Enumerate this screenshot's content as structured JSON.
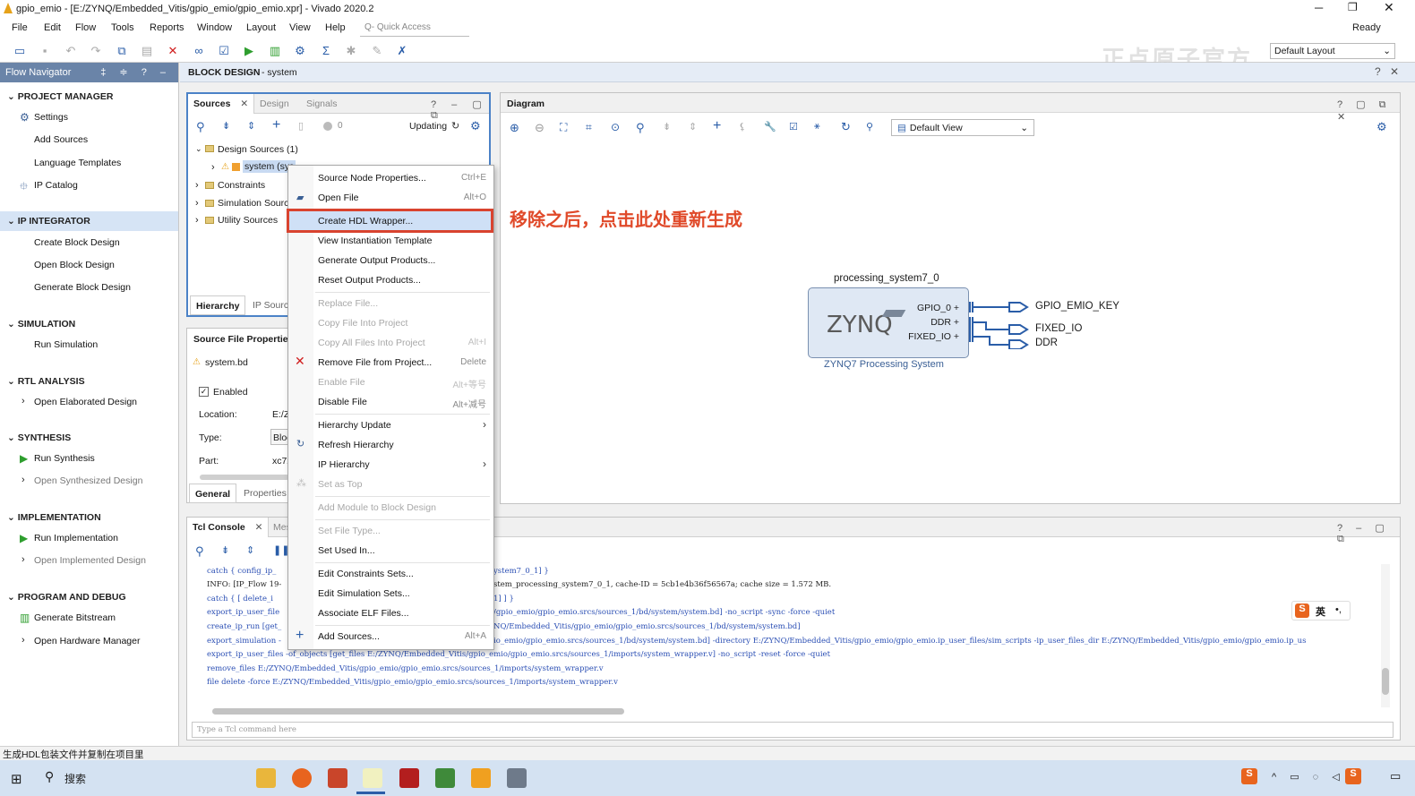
{
  "window": {
    "title": "gpio_emio - [E:/ZYNQ/Embedded_Vitis/gpio_emio/gpio_emio.xpr] - Vivado 2020.2",
    "status": "Ready",
    "watermark": "正点原子官方",
    "layout": "Default Layout"
  },
  "menu": [
    "File",
    "Edit",
    "Flow",
    "Tools",
    "Reports",
    "Window",
    "Layout",
    "View",
    "Help"
  ],
  "quick_access": "Q- Quick Access",
  "flow_nav": {
    "title": "Flow Navigator",
    "sections": [
      {
        "label": "PROJECT MANAGER",
        "items": [
          "Settings",
          "Add Sources",
          "Language Templates",
          "IP Catalog"
        ]
      },
      {
        "label": "IP INTEGRATOR",
        "items": [
          "Create Block Design",
          "Open Block Design",
          "Generate Block Design"
        ]
      },
      {
        "label": "SIMULATION",
        "items": [
          "Run Simulation"
        ]
      },
      {
        "label": "RTL ANALYSIS",
        "items": [
          "Open Elaborated Design"
        ]
      },
      {
        "label": "SYNTHESIS",
        "items": [
          "Run Synthesis",
          "Open Synthesized Design"
        ]
      },
      {
        "label": "IMPLEMENTATION",
        "items": [
          "Run Implementation",
          "Open Implemented Design"
        ]
      },
      {
        "label": "PROGRAM AND DEBUG",
        "items": [
          "Generate Bitstream",
          "Open Hardware Manager"
        ]
      }
    ]
  },
  "block_design": {
    "title": "BLOCK DESIGN",
    "subtitle": "- system"
  },
  "sources": {
    "tabs": [
      "Sources",
      "Design",
      "Signals"
    ],
    "updating": "Updating",
    "count": "0",
    "tree": [
      "Design Sources (1)",
      "system (sys",
      "Constraints",
      "Simulation Source",
      "Utility Sources"
    ],
    "bottom_tabs": [
      "Hierarchy",
      "IP Sourc"
    ]
  },
  "sfp": {
    "title": "Source File Properties",
    "file": "system.bd",
    "enabled": "Enabled",
    "location_label": "Location:",
    "location": "E:/Z",
    "type_label": "Type:",
    "type": "Bloc",
    "part_label": "Part:",
    "part": "xc7z",
    "tabs": [
      "General",
      "Properties"
    ]
  },
  "context_menu": [
    {
      "label": "Source Node Properties...",
      "shortcut": "Ctrl+E",
      "state": "enabled"
    },
    {
      "label": "Open File",
      "shortcut": "Alt+O",
      "state": "enabled"
    },
    {
      "label": "Create HDL Wrapper...",
      "shortcut": "",
      "state": "highlighted"
    },
    {
      "label": "View Instantiation Template",
      "shortcut": "",
      "state": "enabled"
    },
    {
      "label": "Generate Output Products...",
      "shortcut": "",
      "state": "enabled"
    },
    {
      "label": "Reset Output Products...",
      "shortcut": "",
      "state": "enabled"
    },
    {
      "label": "Replace File...",
      "shortcut": "",
      "state": "disabled"
    },
    {
      "label": "Copy File Into Project",
      "shortcut": "",
      "state": "disabled"
    },
    {
      "label": "Copy All Files Into Project",
      "shortcut": "Alt+I",
      "state": "disabled"
    },
    {
      "label": "Remove File from Project...",
      "shortcut": "Delete",
      "state": "enabled"
    },
    {
      "label": "Enable File",
      "shortcut": "Alt+等号",
      "state": "disabled"
    },
    {
      "label": "Disable File",
      "shortcut": "Alt+减号",
      "state": "enabled"
    },
    {
      "label": "Hierarchy Update",
      "shortcut": "›",
      "state": "enabled"
    },
    {
      "label": "Refresh Hierarchy",
      "shortcut": "",
      "state": "enabled"
    },
    {
      "label": "IP Hierarchy",
      "shortcut": "›",
      "state": "enabled"
    },
    {
      "label": "Set as Top",
      "shortcut": "",
      "state": "disabled"
    },
    {
      "label": "Add Module to Block Design",
      "shortcut": "",
      "state": "disabled"
    },
    {
      "label": "Set File Type...",
      "shortcut": "",
      "state": "disabled"
    },
    {
      "label": "Set Used In...",
      "shortcut": "",
      "state": "enabled"
    },
    {
      "label": "Edit Constraints Sets...",
      "shortcut": "",
      "state": "enabled"
    },
    {
      "label": "Edit Simulation Sets...",
      "shortcut": "",
      "state": "enabled"
    },
    {
      "label": "Associate ELF Files...",
      "shortcut": "",
      "state": "enabled"
    },
    {
      "label": "Add Sources...",
      "shortcut": "Alt+A",
      "state": "enabled"
    }
  ],
  "annotation": "移除之后，点击此处重新生成",
  "diagram": {
    "title": "Diagram",
    "view": "Default View",
    "block_name": "processing_system7_0",
    "block_caption": "ZYNQ7 Processing System",
    "logo": "ZYNQ",
    "ports_left": [
      "GPIO_0",
      "DDR",
      "FIXED_IO"
    ],
    "ports_right": [
      "GPIO_EMIO_KEY",
      "FIXED_IO",
      "DDR"
    ]
  },
  "tcl": {
    "tabs": [
      "Tcl Console",
      "Mes"
    ],
    "placeholder": "Type a Tcl command here",
    "lines": [
      "catch { config_ip_",
      "INFO: [IP_Flow 19-",
      "catch { [ delete_i",
      "export_ip_user_file",
      "create_ip_run [get_",
      "export_simulation -",
      "export_ip_user_files -of_objects  [get_files E:/ZYNQ/Embedded_Vitis/gpio_emio/gpio_emio.srcs/sources_1/imports/system_wrapper.v] -no_script -reset -force -quiet",
      "remove_files  E:/ZYNQ/Embedded_Vitis/gpio_emio/gpio_emio.srcs/sources_1/imports/system_wrapper.v",
      "file delete -force E:/ZYNQ/Embedded_Vitis/gpio_emio/gpio_emio.srcs/sources_1/imports/system_wrapper.v"
    ],
    "right_lines": [
      "ystem7_0_1] }",
      "stem_processing_system7_0_1, cache-ID = 5cb1e4b36f56567a; cache size = 1.572 MB.",
      "1] ] }",
      "/gpio_emio/gpio_emio.srcs/sources_1/bd/system/system.bd] -no_script -sync -force -quiet",
      "NQ/Embedded_Vitis/gpio_emio/gpio_emio.srcs/sources_1/bd/system/system.bd]",
      "io_emio/gpio_emio.srcs/sources_1/bd/system/system.bd] -directory E:/ZYNQ/Embedded_Vitis/gpio_emio/gpio_emio.ip_user_files/sim_scripts -ip_user_files_dir E:/ZYNQ/Embedded_Vitis/gpio_emio/gpio_emio.ip_us"
    ]
  },
  "statusbar": "生成HDL包装文件并复制在项目里",
  "taskbar": {
    "search": "搜索",
    "ime": "英"
  },
  "colors": {
    "accent": "#2a5da8",
    "annotation": "#e04a2a",
    "highlight_border": "#d9432f",
    "block_fill": "#dfe8f4"
  }
}
